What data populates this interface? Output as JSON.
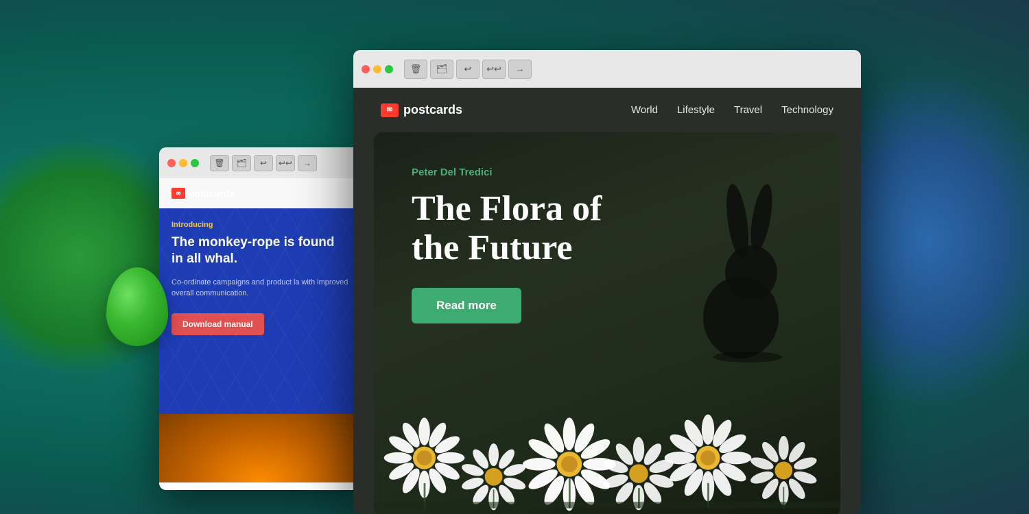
{
  "background": {
    "color_start": "#1a8a7a",
    "color_end": "#1a3a4a"
  },
  "window_back": {
    "traffic_lights": [
      "red",
      "yellow",
      "green"
    ],
    "toolbar": {
      "delete_label": "🗑",
      "archive_label": "🗂",
      "back_label": "↩",
      "forward_all_label": "↩↩",
      "forward_label": "→"
    },
    "email": {
      "logo_text": "postcards",
      "intro_label": "Introducing",
      "headline": "The monkey-rope is found in all whal.",
      "subtext": "Co-ordinate campaigns and product la with improved overall communication.",
      "cta_button": "Download manual",
      "photo_alt": "Lantern photo"
    }
  },
  "window_front": {
    "traffic_lights": [
      "red",
      "yellow",
      "green"
    ],
    "toolbar": {
      "delete_label": "🗑",
      "archive_label": "🗂",
      "back_label": "↩",
      "forward_all_label": "↩↩",
      "forward_label": "→"
    },
    "email": {
      "logo_text": "postcards",
      "nav_links": [
        "World",
        "Lifestyle",
        "Travel",
        "Technology"
      ],
      "author": "Peter Del Tredici",
      "hero_title_line1": "The Flora of",
      "hero_title_line2": "the Future",
      "cta_button": "Read more"
    }
  }
}
